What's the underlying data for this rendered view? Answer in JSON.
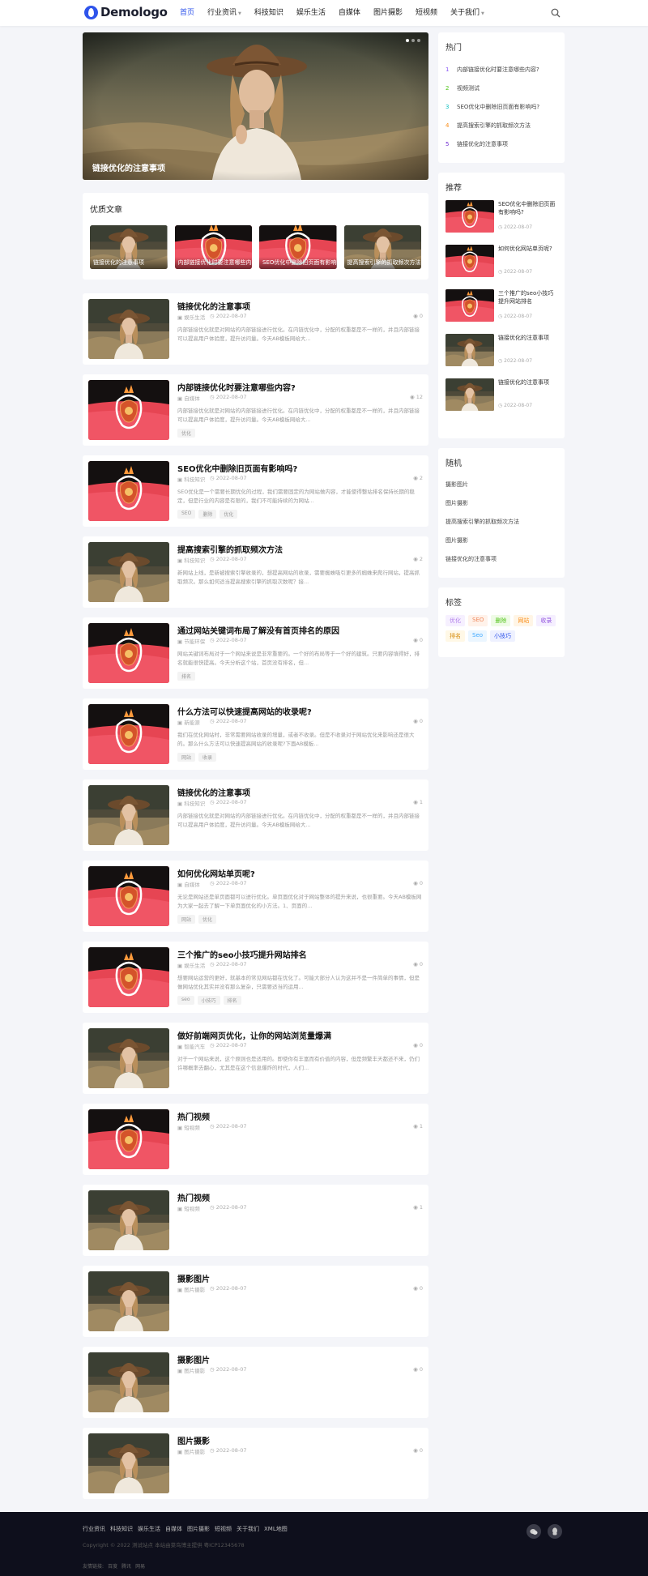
{
  "header": {
    "logo_text": "Demologo",
    "nav": [
      {
        "label": "首页",
        "active": true,
        "dropdown": false
      },
      {
        "label": "行业资讯",
        "active": false,
        "dropdown": true
      },
      {
        "label": "科技知识",
        "active": false,
        "dropdown": false
      },
      {
        "label": "娱乐生活",
        "active": false,
        "dropdown": false
      },
      {
        "label": "自媒体",
        "active": false,
        "dropdown": false
      },
      {
        "label": "图片摄影",
        "active": false,
        "dropdown": false
      },
      {
        "label": "短视频",
        "active": false,
        "dropdown": false
      },
      {
        "label": "关于我们",
        "active": false,
        "dropdown": true
      }
    ],
    "search_icon": "search-icon"
  },
  "slider": {
    "caption": "链接优化的注意事项",
    "dots": 3,
    "active_dot": 0
  },
  "quality": {
    "title": "优质文章",
    "items": [
      {
        "label": "链接优化的注意事项",
        "img": "portrait"
      },
      {
        "label": "内部链接优化时要注意哪些内容?",
        "img": "logo"
      },
      {
        "label": "SEO优化中删除旧页面有影响吗?",
        "img": "logo"
      },
      {
        "label": "提高搜索引擎的抓取频次方法",
        "img": "portrait"
      }
    ]
  },
  "posts": [
    {
      "title": "链接优化的注意事项",
      "img": "portrait",
      "category": "娱乐生活",
      "date": "2022-08-07",
      "views": "0",
      "excerpt": "内部链接优化就是对网站的内部链接进行优化。在内链优化中，分配的权重都是不一样的，并且内部链接可以提高用户体验度，提升访问量。今天AB模板网给大...",
      "tags": []
    },
    {
      "title": "内部链接优化时要注意哪些内容?",
      "img": "logo",
      "category": "自媒体",
      "date": "2022-08-07",
      "views": "12",
      "excerpt": "内部链接优化就是对网站的内部链接进行优化。在内链优化中，分配的权重都是不一样的，并且内部链接可以提高用户体验度，提升访问量。今天AB模板网给大...",
      "tags": [
        "优化"
      ]
    },
    {
      "title": "SEO优化中删除旧页面有影响吗?",
      "img": "logo",
      "category": "科技知识",
      "date": "2022-08-07",
      "views": "2",
      "excerpt": "SEO优化是一个需要长期优化的过程，我们需要固定的为网站做内容，才能使得整站排名保持长期的稳定，但是行业的内容是有限的，我们不可能持续的为网站...",
      "tags": [
        "SEO",
        "删除",
        "优化"
      ]
    },
    {
      "title": "提高搜索引擎的抓取频次方法",
      "img": "portrait",
      "category": "科技知识",
      "date": "2022-08-07",
      "views": "2",
      "excerpt": "新网站上线，是新被搜索引擎收录的，想提高网站的收录，需要蜘蛛吸引更多的蜘蛛来爬行网站，提高抓取频次。那么如何适当提高搜索引擎的抓取次数呢？接...",
      "tags": []
    },
    {
      "title": "通过网站关键词布局了解没有首页排名的原因",
      "img": "logo",
      "category": "节能环保",
      "date": "2022-08-07",
      "views": "0",
      "excerpt": "网站关键词布局对于一个网站来说是非常重要的。一个好的布局等于一个好的建筑。只要内容填得好，排名就能很快提高。今天分析这个站，首页没有排名，但...",
      "tags": [
        "排名"
      ]
    },
    {
      "title": "什么方法可以快速提高网站的收录呢?",
      "img": "logo",
      "category": "新能源",
      "date": "2022-08-07",
      "views": "0",
      "excerpt": "我们在优化网站时，非常需要网站收录的增量，或者不收录。但是不收录对于网站优化来影响还是很大的。那么什么方法可以快速提高网站的收录呢?下面AB模板...",
      "tags": [
        "网站",
        "收录"
      ]
    },
    {
      "title": "链接优化的注意事项",
      "img": "portrait",
      "category": "科技知识",
      "date": "2022-08-07",
      "views": "1",
      "excerpt": "内部链接优化就是对网站的内部链接进行优化。在内链优化中，分配的权重都是不一样的，并且内部链接可以提高用户体验度，提升访问量。今天AB模板网给大...",
      "tags": []
    },
    {
      "title": "如何优化网站单页呢?",
      "img": "logo",
      "category": "自媒体",
      "date": "2022-08-07",
      "views": "0",
      "excerpt": "无论是网站还是单页面都可以进行优化。单页面优化对于网站整体的提升来说，也很重要。今天AB模板网为大家一起去了解一下单页面优化的小方法。1、页面的...",
      "tags": [
        "网站",
        "优化"
      ]
    },
    {
      "title": "三个推广的seo小技巧提升网站排名",
      "img": "logo",
      "category": "娱乐生活",
      "date": "2022-08-07",
      "views": "0",
      "excerpt": "想要网站运营的更好，就基本的常见网站都在优化了。可能大部分人认为这并不是一件简单的事情，但是做网站优化其实并没有那么复杂，只需要适当的运用...",
      "tags": [
        "seo",
        "小技巧",
        "排名"
      ]
    },
    {
      "title": "做好前端网页优化，让你的网站浏览量爆满",
      "img": "portrait",
      "category": "智能汽车",
      "date": "2022-08-07",
      "views": "0",
      "excerpt": "对于一个网站来说，这个原则也是适用的。即使你有丰富而有价值的内容，但是频繁丰天都还不来，仍们许哪概率去翻心，尤其是在这个信息爆炸的时代，人们...",
      "tags": []
    },
    {
      "title": "热门视频",
      "img": "logo",
      "category": "短视频",
      "date": "2022-08-07",
      "views": "1",
      "excerpt": "",
      "tags": []
    },
    {
      "title": "热门视频",
      "img": "portrait",
      "category": "短视频",
      "date": "2022-08-07",
      "views": "1",
      "excerpt": "",
      "tags": []
    },
    {
      "title": "摄影图片",
      "img": "portrait",
      "category": "图片摄影",
      "date": "2022-08-07",
      "views": "0",
      "excerpt": "",
      "tags": []
    },
    {
      "title": "摄影图片",
      "img": "portrait",
      "category": "图片摄影",
      "date": "2022-08-07",
      "views": "0",
      "excerpt": "",
      "tags": []
    },
    {
      "title": "图片摄影",
      "img": "portrait",
      "category": "图片摄影",
      "date": "2022-08-07",
      "views": "0",
      "excerpt": "",
      "tags": []
    }
  ],
  "sidebar": {
    "hot": {
      "title": "热门",
      "items": [
        {
          "num": "1",
          "color": "#8c5cf6",
          "label": "内部链接优化时要注意哪些内容?"
        },
        {
          "num": "2",
          "color": "#52c41a",
          "label": "视频测试"
        },
        {
          "num": "3",
          "color": "#13c2c2",
          "label": "SEO优化中删除旧页面有影响吗?"
        },
        {
          "num": "4",
          "color": "#fa8c16",
          "label": "提高搜索引擎的抓取频次方法"
        },
        {
          "num": "5",
          "color": "#722ed1",
          "label": "链接优化的注意事项"
        }
      ]
    },
    "recommend": {
      "title": "推荐",
      "items": [
        {
          "title": "SEO优化中删除旧页面有影响吗?",
          "date": "2022-08-07",
          "img": "logo"
        },
        {
          "title": "如何优化网站单页呢?",
          "date": "2022-08-07",
          "img": "logo"
        },
        {
          "title": "三个推广的seo小技巧提升网站排名",
          "date": "2022-08-07",
          "img": "logo"
        },
        {
          "title": "链接优化的注意事项",
          "date": "2022-08-07",
          "img": "portrait"
        },
        {
          "title": "链接优化的注意事项",
          "date": "2022-08-07",
          "img": "portrait"
        }
      ]
    },
    "random": {
      "title": "随机",
      "items": [
        "摄影图片",
        "图片摄影",
        "提高搜索引擎的抓取频次方法",
        "图片摄影",
        "链接优化的注意事项"
      ]
    },
    "tags": {
      "title": "标签",
      "items": [
        {
          "label": "优化",
          "color": "#b37feb",
          "bg": "#f6f0ff"
        },
        {
          "label": "SEO",
          "color": "#f08a5d",
          "bg": "#fff2ea"
        },
        {
          "label": "删除",
          "color": "#52c41a",
          "bg": "#effbe6"
        },
        {
          "label": "网站",
          "color": "#fa8c16",
          "bg": "#fff5e6"
        },
        {
          "label": "收录",
          "color": "#9254de",
          "bg": "#f5efff"
        },
        {
          "label": "排名",
          "color": "#d48806",
          "bg": "#fff8e6"
        },
        {
          "label": "Seo",
          "color": "#40a9ff",
          "bg": "#ebf6ff"
        },
        {
          "label": "小技巧",
          "color": "#2f54eb",
          "bg": "#eef1ff"
        }
      ]
    }
  },
  "footer": {
    "links": [
      "行业资讯",
      "科技知识",
      "娱乐生活",
      "自媒体",
      "图片摄影",
      "短视频",
      "关于我们",
      "XML地图"
    ],
    "copyright": "Copyright © 2022 测试站点 本站由菜鸟博主提供 粤ICP12345678",
    "friend_label": "友情链接:",
    "friend_links": [
      "百度",
      "腾讯",
      "网易"
    ],
    "icons": [
      "wechat-icon",
      "qq-icon"
    ]
  }
}
